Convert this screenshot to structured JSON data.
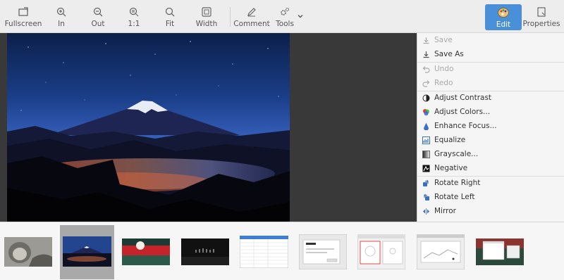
{
  "toolbar": {
    "fullscreen": "Fullscreen",
    "zoom_in": "In",
    "zoom_out": "Out",
    "zoom_1_1": "1:1",
    "fit": "Fit",
    "width": "Width",
    "comment": "Comment",
    "tools": "Tools",
    "edit": "Edit",
    "properties": "Properties"
  },
  "menu": {
    "save": "Save",
    "save_as": "Save As",
    "undo": "Undo",
    "redo": "Redo",
    "adjust_contrast": "Adjust Contrast",
    "adjust_colors": "Adjust Colors...",
    "enhance_focus": "Enhance Focus...",
    "equalize": "Equalize",
    "grayscale": "Grayscale...",
    "negative": "Negative",
    "rotate_right": "Rotate Right",
    "rotate_left": "Rotate Left",
    "mirror": "Mirror"
  },
  "thumbnails": {
    "count": 9,
    "selected_index": 1,
    "items": [
      "cat-photo",
      "mount-fuji-night",
      "red-sun-landscape",
      "dark-panorama",
      "spreadsheet-screenshot",
      "dialog-screenshot",
      "settings-screenshot",
      "dialog-screenshot-2",
      "desktop-screenshot"
    ]
  },
  "colors": {
    "accent": "#4a90d9",
    "viewer_bg": "#393939",
    "toolbar_bg": "#ededed"
  }
}
